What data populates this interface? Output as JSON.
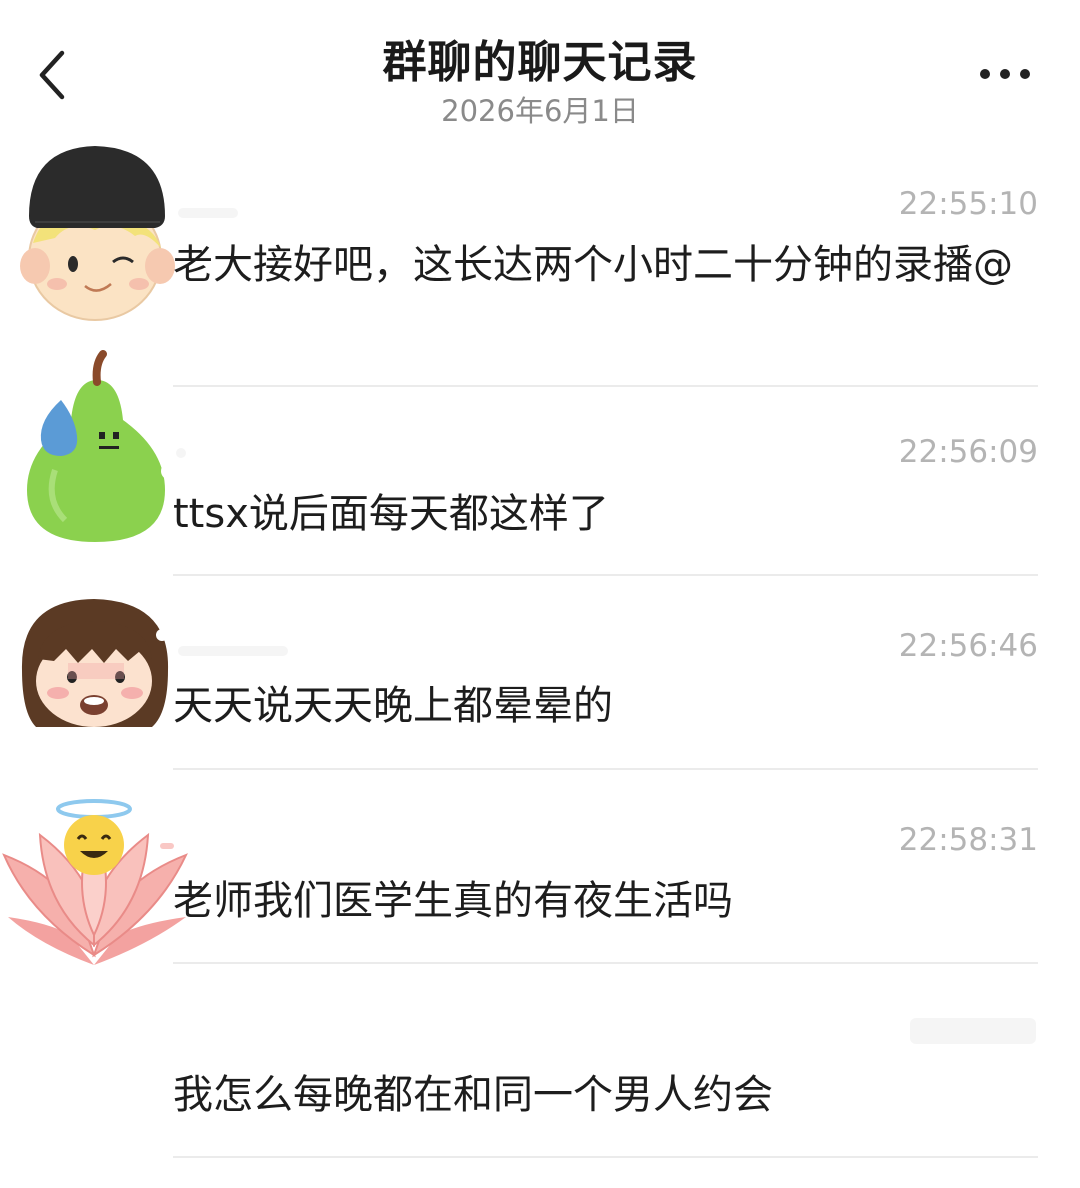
{
  "header": {
    "title": "群聊的聊天记录",
    "date": "2026年6月1日",
    "back_icon": "chevron-left-icon",
    "more_icon": "more-horizontal-icon"
  },
  "messages": [
    {
      "time": "22:55:10",
      "text": "老大接好吧，这长达两个小时二十分钟的录播@",
      "avatar": "boy-beanie-avatar"
    },
    {
      "time": "22:56:09",
      "text": "ttsx说后面每天都这样了",
      "avatar": "green-pear-avatar"
    },
    {
      "time": "22:56:46",
      "text": "天天说天天晚上都晕晕的",
      "avatar": "girl-bangs-avatar"
    },
    {
      "time": "22:58:31",
      "text": "老师我们医学生真的有夜生活吗",
      "avatar": "lotus-angel-avatar"
    },
    {
      "time": "",
      "text": "我怎么每晚都在和同一个男人约会",
      "avatar": ""
    }
  ]
}
